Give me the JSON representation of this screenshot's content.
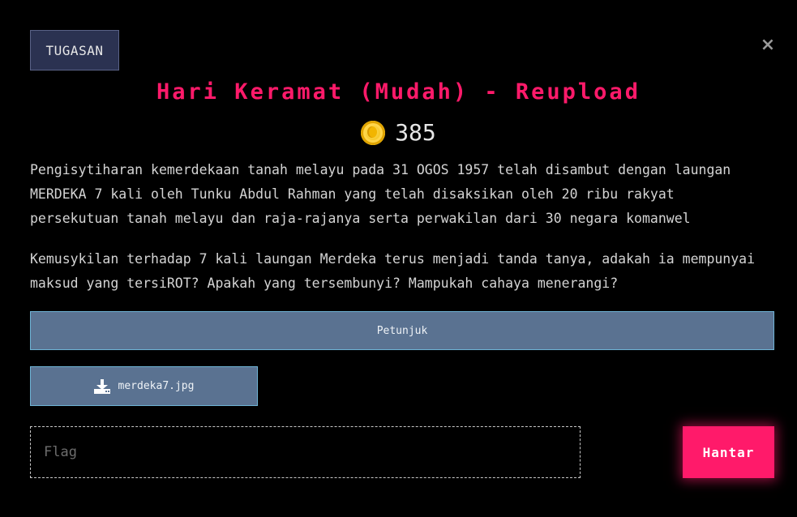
{
  "badge": {
    "label": "TUGASAN"
  },
  "close": {
    "symbol": "×"
  },
  "challenge": {
    "title": "Hari Keramat (Mudah) - Reupload",
    "points": "385",
    "description_1": "Pengisytiharan kemerdekaan tanah melayu pada 31 OGOS 1957 telah disambut dengan laungan\nMERDEKA 7 kali oleh Tunku Abdul Rahman yang telah disaksikan oleh 20 ribu rakyat\npersekutuan tanah melayu dan raja-rajanya serta perwakilan dari 30 negara komanwel",
    "description_2": "Kemusykilan terhadap 7 kali laungan Merdeka terus menjadi tanda tanya, adakah ia mempunyai\nmaksud yang tersiROT? Apakah yang tersembunyi? Mampukah cahaya menerangi?"
  },
  "hint": {
    "label": "Petunjuk"
  },
  "file": {
    "name": "merdeka7.jpg",
    "icon": "download-icon"
  },
  "flag": {
    "placeholder": "Flag",
    "value": ""
  },
  "submit": {
    "label": "Hantar"
  },
  "colors": {
    "accent": "#ff1a6a",
    "button_bg": "#5a7291",
    "button_border": "#6fb4d6",
    "badge_bg": "#2b3251",
    "coin": "#f5c21b"
  }
}
